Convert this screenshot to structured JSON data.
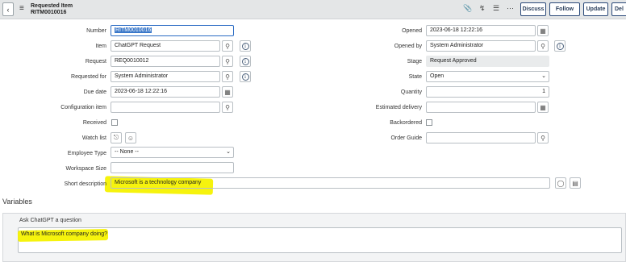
{
  "header": {
    "title": "Requested Item",
    "subtitle": "RITM0010016",
    "buttons": {
      "discuss": "Discuss",
      "follow": "Follow",
      "update": "Update",
      "delete": "Del"
    },
    "icons": [
      "paperclip-icon",
      "activity-icon",
      "settings-icon",
      "more-icon"
    ]
  },
  "form": {
    "number": {
      "label": "Number",
      "value": "RITM0010016"
    },
    "item": {
      "label": "Item",
      "value": "ChatGPT Request"
    },
    "request": {
      "label": "Request",
      "value": "REQ0010012"
    },
    "requested_for": {
      "label": "Requested for",
      "value": "System Administrator"
    },
    "due_date": {
      "label": "Due date",
      "value": "2023-06-18 12:22:16"
    },
    "configuration_item": {
      "label": "Configuration item",
      "value": ""
    },
    "received": {
      "label": "Received",
      "checked": false
    },
    "watch_list": {
      "label": "Watch list"
    },
    "employee_type": {
      "label": "Employee Type",
      "value": "-- None --"
    },
    "workspace_size": {
      "label": "Workspace Size",
      "value": ""
    },
    "short_description": {
      "label": "Short description",
      "value": "Microsoft is a technology company"
    },
    "opened": {
      "label": "Opened",
      "value": "2023-06-18 12:22:16"
    },
    "opened_by": {
      "label": "Opened by",
      "value": "System Administrator"
    },
    "stage": {
      "label": "Stage",
      "value": "Request Approved"
    },
    "state": {
      "label": "State",
      "value": "Open"
    },
    "quantity": {
      "label": "Quantity",
      "value": "1"
    },
    "estimated_delivery": {
      "label": "Estimated delivery",
      "value": ""
    },
    "backordered": {
      "label": "Backordered",
      "checked": false
    },
    "order_guide": {
      "label": "Order Guide",
      "value": ""
    }
  },
  "variables": {
    "title": "Variables",
    "question_label": "Ask ChatGPT a question",
    "question_value": "What is Microsoft company doing?"
  },
  "colors": {
    "highlight": "#f6f200",
    "focus": "#2b6cc4",
    "header_bg": "#e4e6e7"
  }
}
